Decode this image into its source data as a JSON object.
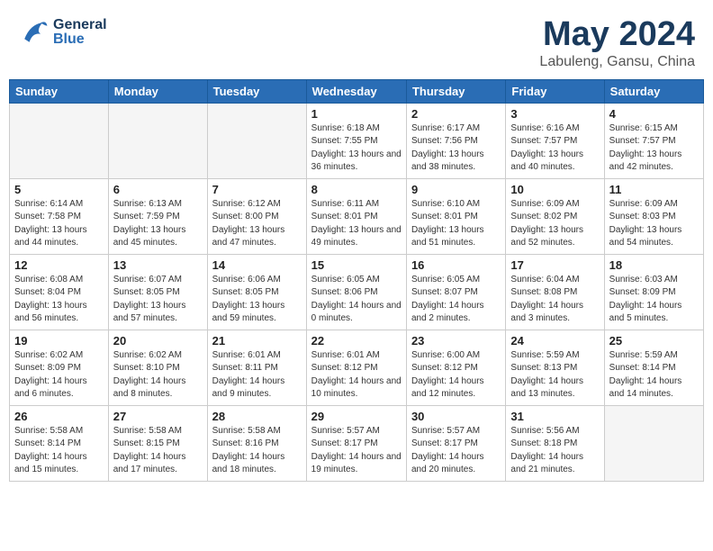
{
  "header": {
    "logo": {
      "general": "General",
      "blue": "Blue"
    },
    "month_year": "May 2024",
    "location": "Labuleng, Gansu, China"
  },
  "weekdays": [
    "Sunday",
    "Monday",
    "Tuesday",
    "Wednesday",
    "Thursday",
    "Friday",
    "Saturday"
  ],
  "weeks": [
    [
      {
        "day": null
      },
      {
        "day": null
      },
      {
        "day": null
      },
      {
        "day": 1,
        "sunrise": "6:18 AM",
        "sunset": "7:55 PM",
        "daylight": "13 hours and 36 minutes."
      },
      {
        "day": 2,
        "sunrise": "6:17 AM",
        "sunset": "7:56 PM",
        "daylight": "13 hours and 38 minutes."
      },
      {
        "day": 3,
        "sunrise": "6:16 AM",
        "sunset": "7:57 PM",
        "daylight": "13 hours and 40 minutes."
      },
      {
        "day": 4,
        "sunrise": "6:15 AM",
        "sunset": "7:57 PM",
        "daylight": "13 hours and 42 minutes."
      }
    ],
    [
      {
        "day": 5,
        "sunrise": "6:14 AM",
        "sunset": "7:58 PM",
        "daylight": "13 hours and 44 minutes."
      },
      {
        "day": 6,
        "sunrise": "6:13 AM",
        "sunset": "7:59 PM",
        "daylight": "13 hours and 45 minutes."
      },
      {
        "day": 7,
        "sunrise": "6:12 AM",
        "sunset": "8:00 PM",
        "daylight": "13 hours and 47 minutes."
      },
      {
        "day": 8,
        "sunrise": "6:11 AM",
        "sunset": "8:01 PM",
        "daylight": "13 hours and 49 minutes."
      },
      {
        "day": 9,
        "sunrise": "6:10 AM",
        "sunset": "8:01 PM",
        "daylight": "13 hours and 51 minutes."
      },
      {
        "day": 10,
        "sunrise": "6:09 AM",
        "sunset": "8:02 PM",
        "daylight": "13 hours and 52 minutes."
      },
      {
        "day": 11,
        "sunrise": "6:09 AM",
        "sunset": "8:03 PM",
        "daylight": "13 hours and 54 minutes."
      }
    ],
    [
      {
        "day": 12,
        "sunrise": "6:08 AM",
        "sunset": "8:04 PM",
        "daylight": "13 hours and 56 minutes."
      },
      {
        "day": 13,
        "sunrise": "6:07 AM",
        "sunset": "8:05 PM",
        "daylight": "13 hours and 57 minutes."
      },
      {
        "day": 14,
        "sunrise": "6:06 AM",
        "sunset": "8:05 PM",
        "daylight": "13 hours and 59 minutes."
      },
      {
        "day": 15,
        "sunrise": "6:05 AM",
        "sunset": "8:06 PM",
        "daylight": "14 hours and 0 minutes."
      },
      {
        "day": 16,
        "sunrise": "6:05 AM",
        "sunset": "8:07 PM",
        "daylight": "14 hours and 2 minutes."
      },
      {
        "day": 17,
        "sunrise": "6:04 AM",
        "sunset": "8:08 PM",
        "daylight": "14 hours and 3 minutes."
      },
      {
        "day": 18,
        "sunrise": "6:03 AM",
        "sunset": "8:09 PM",
        "daylight": "14 hours and 5 minutes."
      }
    ],
    [
      {
        "day": 19,
        "sunrise": "6:02 AM",
        "sunset": "8:09 PM",
        "daylight": "14 hours and 6 minutes."
      },
      {
        "day": 20,
        "sunrise": "6:02 AM",
        "sunset": "8:10 PM",
        "daylight": "14 hours and 8 minutes."
      },
      {
        "day": 21,
        "sunrise": "6:01 AM",
        "sunset": "8:11 PM",
        "daylight": "14 hours and 9 minutes."
      },
      {
        "day": 22,
        "sunrise": "6:01 AM",
        "sunset": "8:12 PM",
        "daylight": "14 hours and 10 minutes."
      },
      {
        "day": 23,
        "sunrise": "6:00 AM",
        "sunset": "8:12 PM",
        "daylight": "14 hours and 12 minutes."
      },
      {
        "day": 24,
        "sunrise": "5:59 AM",
        "sunset": "8:13 PM",
        "daylight": "14 hours and 13 minutes."
      },
      {
        "day": 25,
        "sunrise": "5:59 AM",
        "sunset": "8:14 PM",
        "daylight": "14 hours and 14 minutes."
      }
    ],
    [
      {
        "day": 26,
        "sunrise": "5:58 AM",
        "sunset": "8:14 PM",
        "daylight": "14 hours and 15 minutes."
      },
      {
        "day": 27,
        "sunrise": "5:58 AM",
        "sunset": "8:15 PM",
        "daylight": "14 hours and 17 minutes."
      },
      {
        "day": 28,
        "sunrise": "5:58 AM",
        "sunset": "8:16 PM",
        "daylight": "14 hours and 18 minutes."
      },
      {
        "day": 29,
        "sunrise": "5:57 AM",
        "sunset": "8:17 PM",
        "daylight": "14 hours and 19 minutes."
      },
      {
        "day": 30,
        "sunrise": "5:57 AM",
        "sunset": "8:17 PM",
        "daylight": "14 hours and 20 minutes."
      },
      {
        "day": 31,
        "sunrise": "5:56 AM",
        "sunset": "8:18 PM",
        "daylight": "14 hours and 21 minutes."
      },
      {
        "day": null
      }
    ]
  ]
}
